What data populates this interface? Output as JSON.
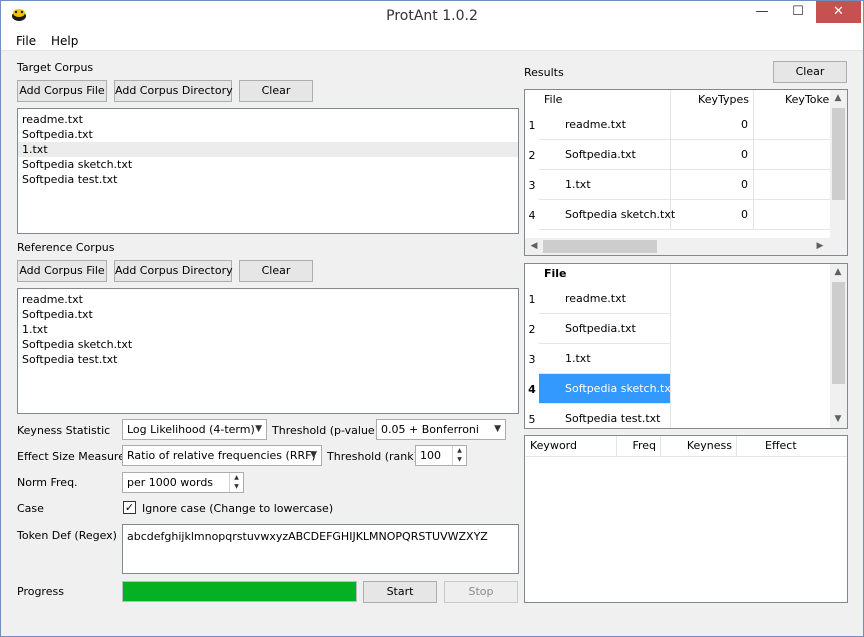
{
  "window": {
    "title": "ProtAnt 1.0.2",
    "controls": {
      "minimize": "—",
      "maximize": "☐",
      "close": "✕"
    }
  },
  "menu": {
    "file": "File",
    "help": "Help"
  },
  "target": {
    "label": "Target Corpus",
    "add_file": "Add Corpus File",
    "add_dir": "Add Corpus Directory",
    "clear": "Clear",
    "files": [
      "readme.txt",
      "Softpedia.txt",
      "1.txt",
      "Softpedia sketch.txt",
      "Softpedia test.txt"
    ]
  },
  "reference": {
    "label": "Reference Corpus",
    "add_file": "Add Corpus File",
    "add_dir": "Add Corpus Directory",
    "clear": "Clear",
    "files": [
      "readme.txt",
      "Softpedia.txt",
      "1.txt",
      "Softpedia sketch.txt",
      "Softpedia test.txt"
    ]
  },
  "settings": {
    "keyness_label": "Keyness Statistic",
    "keyness_value": "Log Likelihood (4-term)",
    "threshold_p_label": "Threshold (p-value)",
    "threshold_p_value": "0.05 + Bonferroni",
    "effect_label": "Effect Size Measure",
    "effect_value": "Ratio of relative frequencies (RRF)",
    "threshold_rank_label": "Threshold (rank)",
    "threshold_rank_value": "100",
    "norm_label": "Norm Freq.",
    "norm_value": "per 1000 words",
    "case_label": "Case",
    "case_checkbox": "Ignore case (Change to lowercase)",
    "case_checked": true,
    "token_label": "Token Def (Regex)",
    "token_value": "abcdefghijklmnopqrstuvwxyzABCDEFGHIJKLMNOPQRSTUVWZXYZ",
    "progress_label": "Progress",
    "progress_fraction": 1.0,
    "start": "Start",
    "stop": "Stop"
  },
  "results": {
    "label": "Results",
    "clear": "Clear",
    "columns": [
      "File",
      "KeyTypes",
      "KeyTokens"
    ],
    "rows": [
      {
        "n": "1",
        "file": "readme.txt",
        "keytypes": "0"
      },
      {
        "n": "2",
        "file": "Softpedia.txt",
        "keytypes": "0"
      },
      {
        "n": "3",
        "file": "1.txt",
        "keytypes": "0"
      },
      {
        "n": "4",
        "file": "Softpedia sketch.txt",
        "keytypes": "0"
      }
    ]
  },
  "file_list": {
    "column": "File",
    "rows": [
      {
        "n": "1",
        "file": "readme.txt"
      },
      {
        "n": "2",
        "file": "Softpedia.txt"
      },
      {
        "n": "3",
        "file": "1.txt"
      },
      {
        "n": "4",
        "file": "Softpedia sketch.txt"
      },
      {
        "n": "5",
        "file": "Softpedia test.txt"
      }
    ],
    "selected_index": 3
  },
  "keywords": {
    "columns": [
      "Keyword",
      "Freq",
      "Keyness",
      "Effect"
    ]
  },
  "colors": {
    "progress": "#06b025",
    "selection": "#3399ff",
    "close_button": "#c75050"
  }
}
